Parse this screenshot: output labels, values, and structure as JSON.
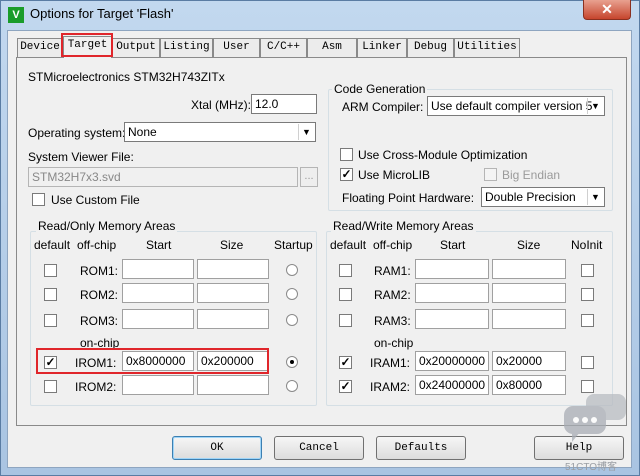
{
  "window": {
    "title": "Options for Target 'Flash'",
    "icon_letter": "V",
    "close_glyph": "✕"
  },
  "tabs": [
    {
      "label": "Device"
    },
    {
      "label": "Target"
    },
    {
      "label": "Output"
    },
    {
      "label": "Listing"
    },
    {
      "label": "User"
    },
    {
      "label": "C/C++"
    },
    {
      "label": "Asm"
    },
    {
      "label": "Linker"
    },
    {
      "label": "Debug"
    },
    {
      "label": "Utilities"
    }
  ],
  "active_tab": "Target",
  "device": {
    "name": "STMicroelectronics STM32H743ZITx"
  },
  "xtal": {
    "label": "Xtal (MHz):",
    "value": "12.0"
  },
  "os": {
    "label": "Operating system:",
    "value": "None"
  },
  "svd": {
    "label": "System Viewer File:",
    "value": "STM32H7x3.svd",
    "browse": "...",
    "custom_label": "Use Custom File"
  },
  "codegen": {
    "title": "Code Generation",
    "compiler_label": "ARM Compiler:",
    "compiler_value": "Use default compiler version 5",
    "cross_module_label": "Use Cross-Module Optimization",
    "microlib_label": "Use MicroLIB",
    "big_endian_label": "Big Endian",
    "fpu_label": "Floating Point Hardware:",
    "fpu_value": "Double Precision"
  },
  "ro": {
    "title": "Read/Only Memory Areas",
    "headers": {
      "default": "default",
      "offchip": "off-chip",
      "start": "Start",
      "size": "Size",
      "startup": "Startup"
    },
    "onchip_label": "on-chip",
    "rows": [
      {
        "name": "ROM1:",
        "start": "",
        "size": "",
        "default": false,
        "startup": false
      },
      {
        "name": "ROM2:",
        "start": "",
        "size": "",
        "default": false,
        "startup": false
      },
      {
        "name": "ROM3:",
        "start": "",
        "size": "",
        "default": false,
        "startup": false
      },
      {
        "name": "IROM1:",
        "start": "0x8000000",
        "size": "0x200000",
        "default": true,
        "startup": true
      },
      {
        "name": "IROM2:",
        "start": "",
        "size": "",
        "default": false,
        "startup": false
      }
    ]
  },
  "rw": {
    "title": "Read/Write Memory Areas",
    "headers": {
      "default": "default",
      "offchip": "off-chip",
      "start": "Start",
      "size": "Size",
      "noinit": "NoInit"
    },
    "onchip_label": "on-chip",
    "rows": [
      {
        "name": "RAM1:",
        "start": "",
        "size": "",
        "default": false
      },
      {
        "name": "RAM2:",
        "start": "",
        "size": "",
        "default": false
      },
      {
        "name": "RAM3:",
        "start": "",
        "size": "",
        "default": false
      },
      {
        "name": "IRAM1:",
        "start": "0x20000000",
        "size": "0x20000",
        "default": true
      },
      {
        "name": "IRAM2:",
        "start": "0x24000000",
        "size": "0x80000",
        "default": true
      }
    ]
  },
  "buttons": {
    "ok": "OK",
    "cancel": "Cancel",
    "defaults": "Defaults",
    "help": "Help"
  },
  "check_glyph": "✓",
  "watermark_text": "51CTO博客",
  "colors": {
    "highlight_red": "#e0262b",
    "title_bar": "#b9d1ea"
  }
}
